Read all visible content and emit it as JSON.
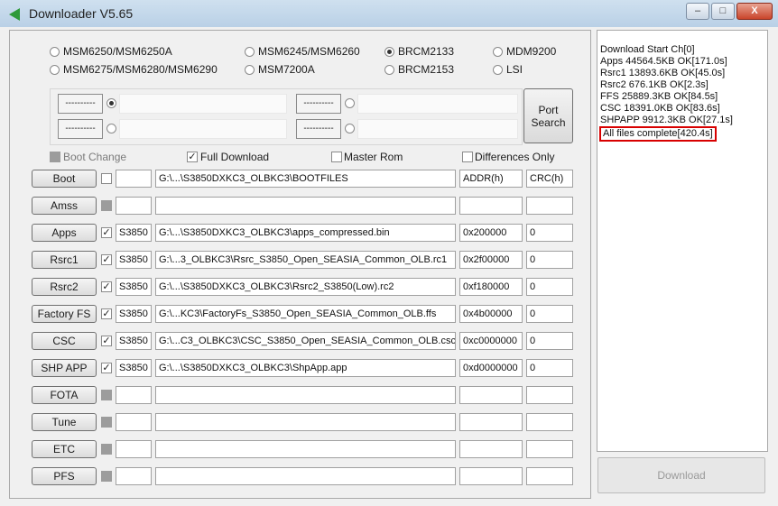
{
  "window": {
    "title": "Downloader V5.65",
    "minimize": "–",
    "maximize": "□",
    "close": "X"
  },
  "models": [
    {
      "label": "MSM6250/MSM6250A",
      "selected": false
    },
    {
      "label": "MSM6275/MSM6280/MSM6290",
      "selected": false
    },
    {
      "label": "MSM6245/MSM6260",
      "selected": false
    },
    {
      "label": "MSM7200A",
      "selected": false
    },
    {
      "label": "BRCM2133",
      "selected": true
    },
    {
      "label": "BRCM2153",
      "selected": false
    },
    {
      "label": "MDM9200",
      "selected": false
    },
    {
      "label": "LSI",
      "selected": false
    }
  ],
  "ports": {
    "dash": "----------",
    "search_label_1": "Port",
    "search_label_2": "Search"
  },
  "options": {
    "boot_change": "Boot Change",
    "full_download": "Full Download",
    "master_rom": "Master Rom",
    "differences_only": "Differences Only"
  },
  "rows": [
    {
      "label": "Boot",
      "checked": false,
      "enabled": true,
      "model": "",
      "path": "G:\\...\\S3850DXKC3_OLBKC3\\BOOTFILES",
      "addr": "ADDR(h)",
      "crc": "CRC(h)"
    },
    {
      "label": "Amss",
      "checked": false,
      "enabled": false,
      "model": "",
      "path": "",
      "addr": "",
      "crc": ""
    },
    {
      "label": "Apps",
      "checked": true,
      "enabled": true,
      "model": "S3850",
      "path": "G:\\...\\S3850DXKC3_OLBKC3\\apps_compressed.bin",
      "addr": "0x200000",
      "crc": "0"
    },
    {
      "label": "Rsrc1",
      "checked": true,
      "enabled": true,
      "model": "S3850",
      "path": "G:\\...3_OLBKC3\\Rsrc_S3850_Open_SEASIA_Common_OLB.rc1",
      "addr": "0x2f00000",
      "crc": "0"
    },
    {
      "label": "Rsrc2",
      "checked": true,
      "enabled": true,
      "model": "S3850",
      "path": "G:\\...\\S3850DXKC3_OLBKC3\\Rsrc2_S3850(Low).rc2",
      "addr": "0xf180000",
      "crc": "0"
    },
    {
      "label": "Factory FS",
      "checked": true,
      "enabled": true,
      "model": "S3850",
      "path": "G:\\...KC3\\FactoryFs_S3850_Open_SEASIA_Common_OLB.ffs",
      "addr": "0x4b00000",
      "crc": "0"
    },
    {
      "label": "CSC",
      "checked": true,
      "enabled": true,
      "model": "S3850",
      "path": "G:\\...C3_OLBKC3\\CSC_S3850_Open_SEASIA_Common_OLB.csc",
      "addr": "0xc0000000",
      "crc": "0"
    },
    {
      "label": "SHP APP",
      "checked": true,
      "enabled": true,
      "model": "S3850",
      "path": "G:\\...\\S3850DXKC3_OLBKC3\\ShpApp.app",
      "addr": "0xd0000000",
      "crc": "0"
    },
    {
      "label": "FOTA",
      "checked": false,
      "enabled": false,
      "model": "",
      "path": "",
      "addr": "",
      "crc": ""
    },
    {
      "label": "Tune",
      "checked": false,
      "enabled": false,
      "model": "",
      "path": "",
      "addr": "",
      "crc": ""
    },
    {
      "label": "ETC",
      "checked": false,
      "enabled": false,
      "model": "",
      "path": "",
      "addr": "",
      "crc": ""
    },
    {
      "label": "PFS",
      "checked": false,
      "enabled": false,
      "model": "",
      "path": "",
      "addr": "",
      "crc": ""
    }
  ],
  "log": [
    "Download Start Ch[0]",
    "Apps 44564.5KB OK[171.0s]",
    "Rsrc1 13893.6KB OK[45.0s]",
    "Rsrc2 676.1KB OK[2.3s]",
    "FFS 25889.3KB OK[84.5s]",
    "CSC 18391.0KB OK[83.6s]",
    "SHPAPP 9912.3KB OK[27.1s]",
    "All files complete[420.4s]"
  ],
  "download_button": "Download",
  "colors": {
    "highlight": "#d80000",
    "titlebar": "#c3d8eb"
  }
}
